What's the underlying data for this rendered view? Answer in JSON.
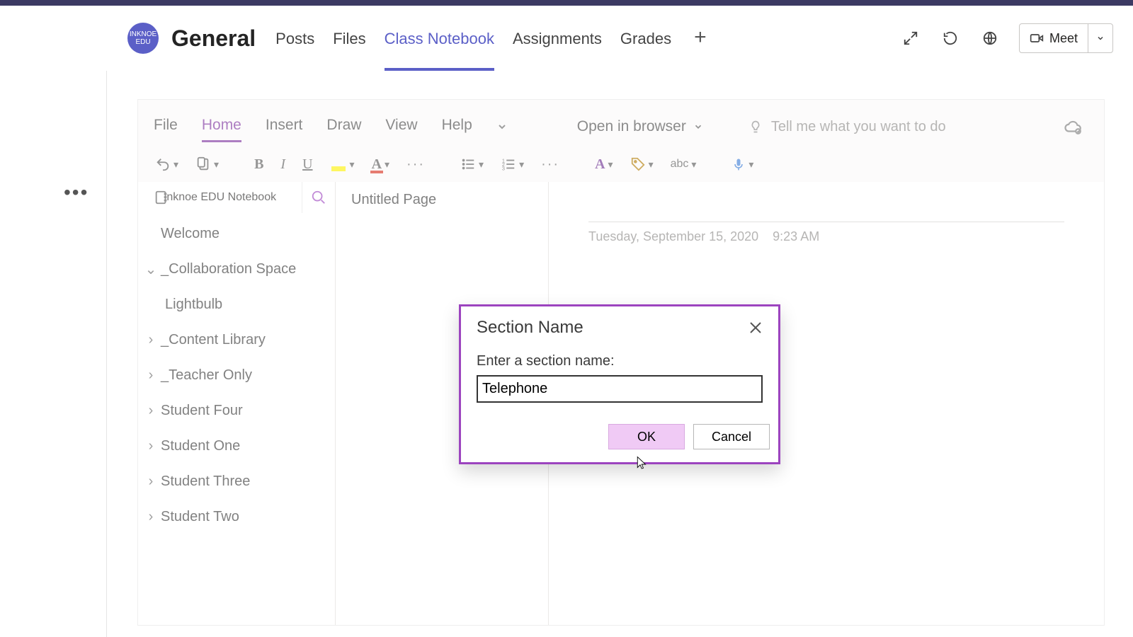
{
  "team_avatar_text": "INKNOE EDU",
  "channel_title": "General",
  "tabs": {
    "posts": "Posts",
    "files": "Files",
    "class_notebook": "Class Notebook",
    "assignments": "Assignments",
    "grades": "Grades"
  },
  "meet_label": "Meet",
  "one_tabs": {
    "file": "File",
    "home": "Home",
    "insert": "Insert",
    "draw": "Draw",
    "view": "View",
    "help": "Help",
    "open_browser": "Open in browser",
    "tell_me_placeholder": "Tell me what you want to do"
  },
  "toolbar": {
    "bold": "B",
    "italic": "I",
    "underline": "U",
    "more": "···",
    "abc": "abc"
  },
  "notebook_title": "Inknoe EDU Notebook",
  "sections": {
    "welcome": "Welcome",
    "collab": "_Collaboration Space",
    "lightbulb": "Lightbulb",
    "content": "_Content Library",
    "teacher": "_Teacher Only",
    "s4": "Student Four",
    "s1": "Student One",
    "s3": "Student Three",
    "s2": "Student Two"
  },
  "page_untitled": "Untitled Page",
  "page_date": "Tuesday, September 15, 2020",
  "page_time": "9:23 AM",
  "dialog": {
    "title": "Section Name",
    "label": "Enter a section name:",
    "value": "Telephone",
    "ok": "OK",
    "cancel": "Cancel"
  }
}
